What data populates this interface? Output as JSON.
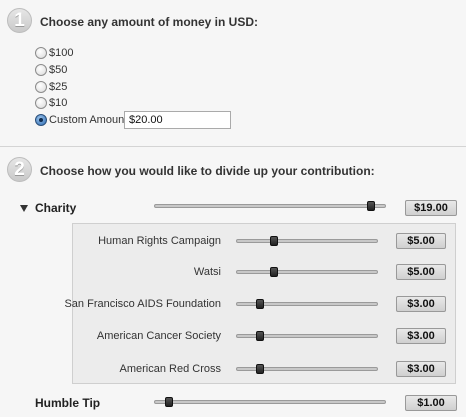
{
  "step1": {
    "number": "1",
    "title": "Choose any amount of money in USD:",
    "options": [
      {
        "label": "$100",
        "checked": false
      },
      {
        "label": "$50",
        "checked": false
      },
      {
        "label": "$25",
        "checked": false
      },
      {
        "label": "$10",
        "checked": false
      },
      {
        "label": "Custom Amount",
        "checked": true
      }
    ],
    "custom_amount_value": "$20.00"
  },
  "step2": {
    "number": "2",
    "title": "Choose how you would like to divide up your contribution:",
    "charity": {
      "label": "Charity",
      "total": "$19.00",
      "slider_fraction": 0.95,
      "items": [
        {
          "name": "Human Rights Campaign",
          "amount": "$5.00",
          "slider_fraction": 0.25
        },
        {
          "name": "Watsi",
          "amount": "$5.00",
          "slider_fraction": 0.25
        },
        {
          "name": "San Francisco AIDS Foundation",
          "amount": "$3.00",
          "slider_fraction": 0.15
        },
        {
          "name": "American Cancer Society",
          "amount": "$3.00",
          "slider_fraction": 0.15
        },
        {
          "name": "American Red Cross",
          "amount": "$3.00",
          "slider_fraction": 0.15
        }
      ]
    },
    "tip": {
      "label": "Humble Tip",
      "amount": "$1.00",
      "slider_fraction": 0.05
    }
  }
}
